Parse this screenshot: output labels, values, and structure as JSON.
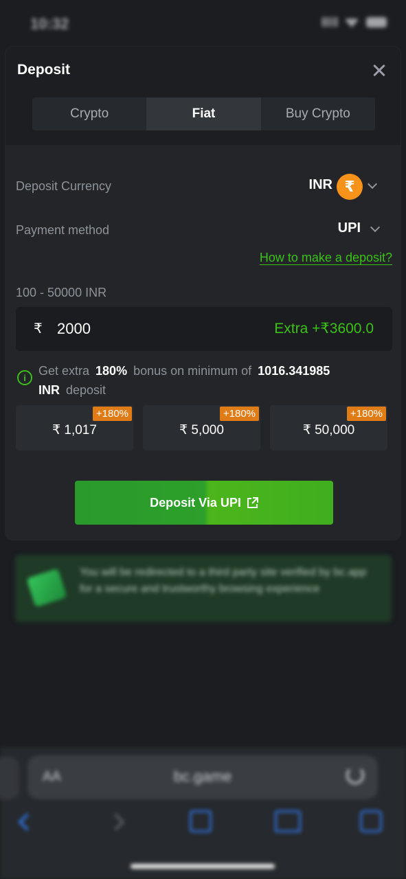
{
  "status_bar": {
    "time": "10:32"
  },
  "modal": {
    "title": "Deposit",
    "tabs": [
      {
        "label": "Crypto",
        "active": false
      },
      {
        "label": "Fiat",
        "active": true
      },
      {
        "label": "Buy Crypto",
        "active": false
      }
    ],
    "deposit_currency": {
      "label": "Deposit Currency",
      "value": "INR",
      "symbol": "₹"
    },
    "payment_method": {
      "label": "Payment method",
      "value": "UPI"
    },
    "how_to_link": "How to make a deposit?",
    "range": "100 - 50000 INR",
    "amount": {
      "symbol": "₹",
      "value": "2000",
      "extra": "Extra +₹3600.0"
    },
    "bonus": {
      "part1": "Get extra",
      "percent": "180%",
      "part2": "bonus on minimum of",
      "min_amount": "1016.341985",
      "currency": "INR",
      "part3": "deposit"
    },
    "quick_amounts": [
      {
        "tag": "+180%",
        "value": "₹ 1,017"
      },
      {
        "tag": "+180%",
        "value": "₹ 5,000"
      },
      {
        "tag": "+180%",
        "value": "₹ 50,000"
      }
    ],
    "deposit_button": "Deposit Via UPI"
  },
  "banner": {
    "text": "You will be redirected to a third party site verified by bc.app for a secure and trustworthy browsing experience"
  },
  "browser": {
    "aa": "AA",
    "url": "bc.game"
  },
  "colors": {
    "accent_green": "#3bc117",
    "badge_orange": "#e07c16",
    "rupee_orange": "#f7931a"
  }
}
